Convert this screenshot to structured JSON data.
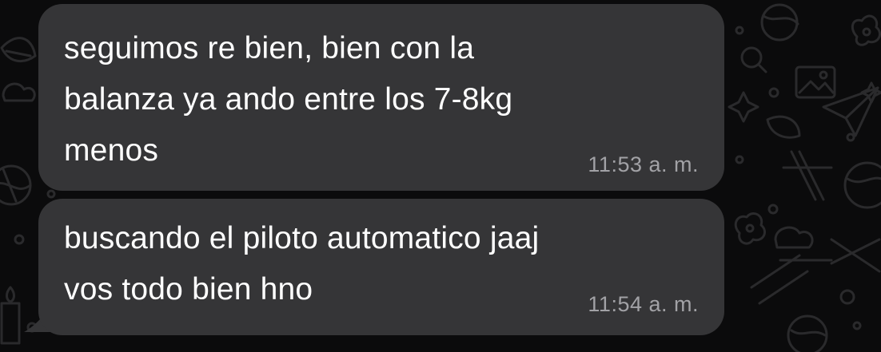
{
  "theme": {
    "background": "#0b0b0c",
    "bubble": "#353537",
    "text": "#ffffff",
    "timestamp": "#a2a2a6",
    "doodle": "#2a2a2c"
  },
  "messages": [
    {
      "text": "seguimos re bien, bien con la\nbalanza ya ando entre los 7-8kg\nmenos",
      "time": "11:53 a. m."
    },
    {
      "text": "buscando el piloto automatico jaaj\nvos todo bien hno",
      "time": "11:54 a. m."
    }
  ],
  "wallpaper_icons": [
    "planet-icon",
    "magnifier-icon",
    "sparkle-icon",
    "image-icon",
    "paper-plane-icon",
    "circle-icon",
    "candle-icon",
    "leaf-icon",
    "cloud-icon",
    "flower-icon",
    "scissors-icon"
  ]
}
